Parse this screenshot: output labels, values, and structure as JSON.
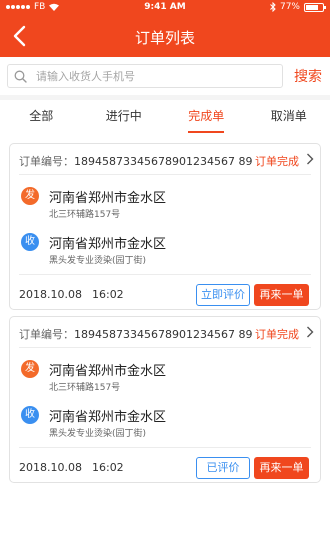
{
  "status_bar": {
    "carrier": "FB",
    "time": "9:41 AM",
    "battery": "77%",
    "battery_level": 0.77
  },
  "header": {
    "title": "订单列表"
  },
  "search": {
    "placeholder": "请输入收货人手机号",
    "value": "",
    "button_label": "搜索"
  },
  "tabs": [
    {
      "label": "全部",
      "active": false
    },
    {
      "label": "进行中",
      "active": false
    },
    {
      "label": "完成单",
      "active": true
    },
    {
      "label": "取消单",
      "active": false
    }
  ],
  "orders": [
    {
      "order_label": "订单编号：",
      "order_number": "18945873345678901234567 89",
      "status": "订单完成",
      "sender_badge": "发",
      "sender_main": "河南省郑州市金水区",
      "sender_sub": "北三环辅路157号",
      "receiver_badge": "收",
      "receiver_main": "河南省郑州市金水区",
      "receiver_sub": "黑头发专业烫染(园丁街)",
      "date": "2018.10.08",
      "time": "16:02",
      "review_button": "立即评价",
      "reorder_button": "再来一单"
    },
    {
      "order_label": "订单编号：",
      "order_number": "18945873345678901234567 89",
      "status": "订单完成",
      "sender_badge": "发",
      "sender_main": "河南省郑州市金水区",
      "sender_sub": "北三环辅路157号",
      "receiver_badge": "收",
      "receiver_main": "河南省郑州市金水区",
      "receiver_sub": "黑头发专业烫染(园丁街)",
      "date": "2018.10.08",
      "time": "16:02",
      "review_button": "已评价",
      "reorder_button": "再来一单"
    }
  ],
  "colors": {
    "accent": "#f0471e",
    "blue": "#3a8ff0",
    "sender": "#f36a2a"
  },
  "icons": {
    "back": "chevron-left-icon",
    "search": "search-icon",
    "detail": "chevron-right-icon",
    "bluetooth": "bluetooth-icon",
    "wifi": "wifi-icon",
    "battery": "battery-icon"
  }
}
